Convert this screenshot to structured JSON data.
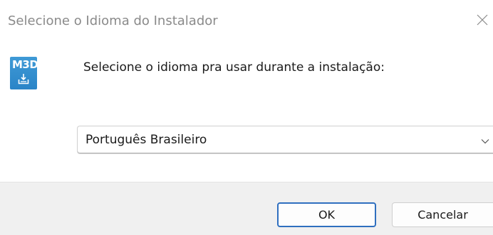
{
  "window": {
    "title": "Selecione o Idioma do Instalador",
    "close_icon": "close-icon"
  },
  "app_icon": {
    "logo_text": "M3D",
    "icon": "installer-download-icon",
    "color": "#2a84c7"
  },
  "content": {
    "prompt": "Selecione o idioma pra usar durante a instalação:"
  },
  "language_select": {
    "selected_value": "Português Brasileiro",
    "icon": "chevron-down-icon"
  },
  "buttons": {
    "ok_label": "OK",
    "cancel_label": "Cancelar",
    "default_accent": "#2f6fbf"
  }
}
